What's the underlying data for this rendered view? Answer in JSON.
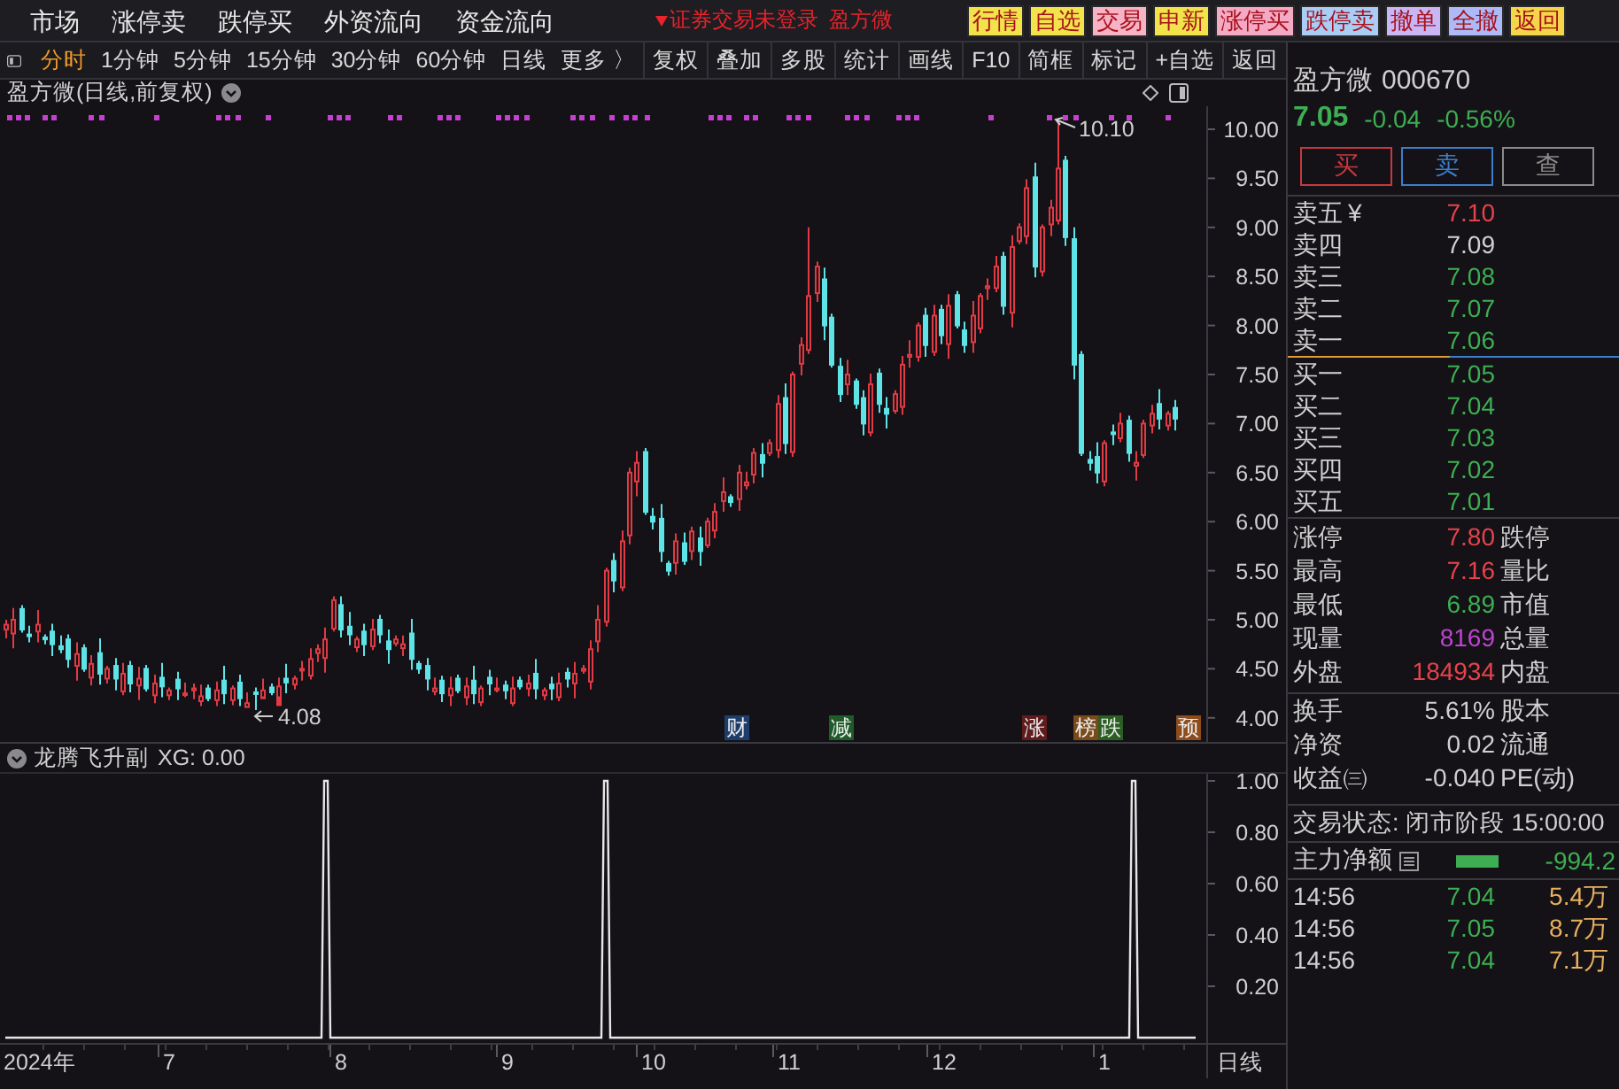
{
  "menu_bar": {
    "items": [
      "市场",
      "涨停卖",
      "跌停买",
      "外资流向",
      "资金流向"
    ],
    "notice": "证券交易未登录",
    "notice_stock": "盈方微",
    "shortcuts": [
      {
        "label": "行情",
        "color": "#f2e24c"
      },
      {
        "label": "自选",
        "color": "#f2e24c"
      },
      {
        "label": "交易",
        "color": "#f7b3c6"
      },
      {
        "label": "申新",
        "color": "#f2e24c"
      },
      {
        "label": "涨停买",
        "color": "#f4a9c4"
      },
      {
        "label": "跌停卖",
        "color": "#a9cdf5"
      },
      {
        "label": "撤单",
        "color": "#c9b6f5"
      },
      {
        "label": "全撤",
        "color": "#aebaf7"
      },
      {
        "label": "返回",
        "color": "#f5d64a"
      }
    ]
  },
  "period_tabs": [
    {
      "label": "分时",
      "selected": true
    },
    {
      "label": "1分钟",
      "selected": false
    },
    {
      "label": "5分钟",
      "selected": false
    },
    {
      "label": "15分钟",
      "selected": false
    },
    {
      "label": "30分钟",
      "selected": false
    },
    {
      "label": "60分钟",
      "selected": false
    },
    {
      "label": "日线",
      "selected": false
    },
    {
      "label": "更多 〉",
      "selected": false
    }
  ],
  "toolbar": [
    "复权",
    "叠加",
    "多股",
    "统计",
    "画线",
    "F10",
    "简框",
    "标记",
    "+自选",
    "返回"
  ],
  "price_chart": {
    "title": "盈方微(日线,前复权)",
    "high_label": "10.10",
    "low_label": "4.08",
    "axis_labels": [
      "10.00",
      "9.50",
      "9.00",
      "8.50",
      "8.00",
      "7.50",
      "7.00",
      "6.50",
      "6.00",
      "5.50",
      "5.00",
      "4.50",
      "4.00"
    ],
    "events": [
      {
        "label": "财",
        "color": "#1d3d6b"
      },
      {
        "label": "减",
        "color": "#1f5c2a"
      },
      {
        "label": "涨",
        "color": "#5e1c1c"
      },
      {
        "label": "榜",
        "color": "#7a4a1a"
      },
      {
        "label": "跌",
        "color": "#2b5e22"
      },
      {
        "label": "预",
        "color": "#8c4c1c"
      }
    ]
  },
  "indicator": {
    "title": "龙腾飞升副",
    "reading": "XG: 0.00",
    "axis_labels": [
      "1.00",
      "0.80",
      "0.60",
      "0.40",
      "0.20"
    ]
  },
  "date_axis": {
    "labels": [
      "2024年",
      "7",
      "8",
      "9",
      "10",
      "11",
      "12",
      "1"
    ],
    "period": "日线"
  },
  "quote": {
    "name": "盈方微",
    "code": "000670",
    "price": "7.05",
    "change": "-0.04",
    "change_percent": "-0.56%",
    "color": "#3dae52"
  },
  "trade_buttons": [
    {
      "label": "买",
      "color": "#c8383e"
    },
    {
      "label": "卖",
      "color": "#3b7fcc"
    },
    {
      "label": "查",
      "color": "#8a8a8a"
    }
  ],
  "order_book": {
    "asks": [
      {
        "label": "卖五",
        "mark": "¥",
        "price": "7.10",
        "color": "#e5434b"
      },
      {
        "label": "卖四",
        "price": "7.09",
        "color": "#d0d0d0"
      },
      {
        "label": "卖三",
        "price": "7.08",
        "color": "#3dae52"
      },
      {
        "label": "卖二",
        "price": "7.07",
        "color": "#3dae52"
      },
      {
        "label": "卖一",
        "price": "7.06",
        "color": "#3dae52"
      }
    ],
    "bids": [
      {
        "label": "买一",
        "price": "7.05",
        "color": "#3dae52"
      },
      {
        "label": "买二",
        "price": "7.04",
        "color": "#3dae52"
      },
      {
        "label": "买三",
        "price": "7.03",
        "color": "#3dae52"
      },
      {
        "label": "买四",
        "price": "7.02",
        "color": "#3dae52"
      },
      {
        "label": "买五",
        "price": "7.01",
        "color": "#3dae52"
      }
    ]
  },
  "stat_groups": [
    {
      "rows": [
        {
          "label": "涨停",
          "value": "7.80",
          "color": "#e5434b",
          "label_2": "跌停"
        },
        {
          "label": "最高",
          "value": "7.16",
          "color": "#e5434b",
          "label_2": "量比"
        },
        {
          "label": "最低",
          "value": "6.89",
          "color": "#3dae52",
          "label_2": "市值"
        },
        {
          "label": "现量",
          "value": "8169",
          "color": "#bd44d0",
          "label_2": "总量"
        },
        {
          "label": "外盘",
          "value": "184934",
          "color": "#e5434b",
          "label_2": "内盘"
        }
      ]
    },
    {
      "rows": [
        {
          "label": "换手",
          "value": "5.61%",
          "label_2": "股本"
        },
        {
          "label": "净资",
          "value": "0.02",
          "label_2": "流通"
        },
        {
          "label": "收益㈢",
          "value": "-0.040",
          "label_2": "PE(动)"
        }
      ]
    }
  ],
  "trade_status": "交易状态: 闭市阶段 15:00:00",
  "main_force": {
    "label": "主力净额",
    "value": "-994.2",
    "color": "#3dae52"
  },
  "ticks": [
    {
      "time": "14:56",
      "price": "7.04",
      "volume": "5.4万",
      "color": "#3dae52"
    },
    {
      "time": "14:56",
      "price": "7.05",
      "volume": "8.7万",
      "color": "#3dae52"
    },
    {
      "time": "14:56",
      "price": "7.04",
      "volume": "7.1万",
      "color": "#3dae52"
    }
  ]
}
